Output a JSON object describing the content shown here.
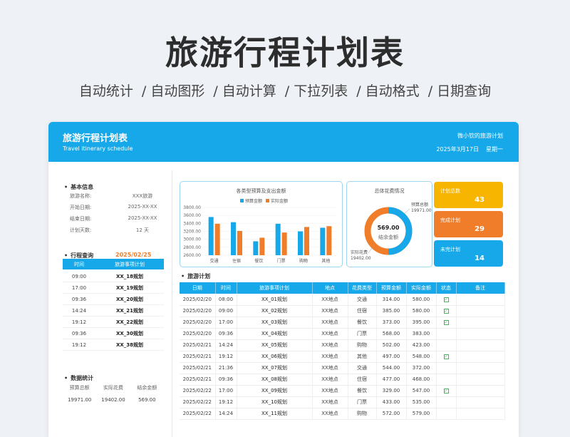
{
  "hero": {
    "title": "旅游行程计划表",
    "features": [
      "自动统计",
      "/ 自动图形",
      "/ 自动计算",
      "/ 下拉列表",
      "/ 自动格式",
      "/ 日期查询"
    ]
  },
  "header": {
    "title": "旅游行程计划表",
    "subtitle": "Travel itinerary schedule",
    "author": "微小钦的旅游计划",
    "date": "2025年3月17日",
    "weekday": "星期一"
  },
  "basic_info": {
    "title": "基本信息",
    "rows": [
      {
        "label": "旅游名称:",
        "value": "XXX旅游"
      },
      {
        "label": "开始日期:",
        "value": "2025-XX-XX"
      },
      {
        "label": "结束日期:",
        "value": "2025-XX-XX"
      },
      {
        "label": "计划天数:",
        "value": "12  天"
      }
    ]
  },
  "schedule_query": {
    "title": "行程查询",
    "date": "2025/02/25",
    "columns": [
      "时间",
      "旅游事项计划"
    ],
    "rows": [
      [
        "09:00",
        "XX_18规划"
      ],
      [
        "17:00",
        "XX_19规划"
      ],
      [
        "09:36",
        "XX_20规划"
      ],
      [
        "14:24",
        "XX_21规划"
      ],
      [
        "19:12",
        "XX_22规划"
      ],
      [
        "09:36",
        "XX_30规划"
      ],
      [
        "19:12",
        "XX_38规划"
      ]
    ]
  },
  "data_stats": {
    "title": "数据统计",
    "labels": [
      "预算总额",
      "实际花费",
      "结余金额"
    ],
    "values": [
      "19971.00",
      "19402.00",
      "569.00"
    ]
  },
  "bar_panel": {
    "title": "各类型预算及支出金额",
    "legend": [
      "预算金额",
      "实际金额"
    ],
    "colors": {
      "budget": "#16a8e8",
      "actual": "#f07d2a"
    }
  },
  "donut_panel": {
    "title": "总体花费情况",
    "center_value": "569.00",
    "center_label": "结余金额",
    "budget_label": "预算总额",
    "budget_value": "19971.00",
    "actual_label": "实际花费",
    "actual_value": "19402.00"
  },
  "kpis": [
    {
      "label": "计划总数",
      "value": "43",
      "color": "#f7b500"
    },
    {
      "label": "完成计划",
      "value": "29",
      "color": "#f07d2a"
    },
    {
      "label": "未完计划",
      "value": "14",
      "color": "#16a8e8"
    }
  ],
  "itinerary": {
    "title": "旅游计划",
    "columns": [
      "日期",
      "时间",
      "旅游事项计划",
      "地点",
      "花费类型",
      "预算金额",
      "实际金额",
      "状态",
      "备注"
    ],
    "rows": [
      [
        "2025/02/20",
        "08:00",
        "XX_01规划",
        "XX地点",
        "交通",
        "314.00",
        "580.00",
        true
      ],
      [
        "2025/02/20",
        "09:00",
        "XX_02规划",
        "XX地点",
        "住宿",
        "385.00",
        "580.00",
        true
      ],
      [
        "2025/02/20",
        "17:00",
        "XX_03规划",
        "XX地点",
        "餐饮",
        "373.00",
        "395.00",
        true
      ],
      [
        "2025/02/20",
        "09:36",
        "XX_04规划",
        "XX地点",
        "门票",
        "568.00",
        "383.00",
        false
      ],
      [
        "2025/02/21",
        "14:24",
        "XX_05规划",
        "XX地点",
        "购物",
        "502.00",
        "423.00",
        false
      ],
      [
        "2025/02/21",
        "19:12",
        "XX_06规划",
        "XX地点",
        "其他",
        "497.00",
        "548.00",
        true
      ],
      [
        "2025/02/21",
        "21:36",
        "XX_07规划",
        "XX地点",
        "交通",
        "544.00",
        "372.00",
        false
      ],
      [
        "2025/02/21",
        "09:36",
        "XX_08规划",
        "XX地点",
        "住宿",
        "477.00",
        "468.00",
        false
      ],
      [
        "2025/02/22",
        "17:00",
        "XX_09规划",
        "XX地点",
        "餐饮",
        "329.00",
        "547.00",
        true
      ],
      [
        "2025/02/22",
        "19:12",
        "XX_10规划",
        "XX地点",
        "门票",
        "433.00",
        "535.00",
        false
      ],
      [
        "2025/02/22",
        "14:24",
        "XX_11规划",
        "XX地点",
        "购物",
        "572.00",
        "579.00",
        false
      ]
    ]
  },
  "chart_data": {
    "type": "bar",
    "title": "各类型预算及支出金额",
    "categories": [
      "交通",
      "住宿",
      "餐饮",
      "门票",
      "购物",
      "其他"
    ],
    "series": [
      {
        "name": "预算金额",
        "values": [
          3560,
          3430,
          2950,
          3390,
          3200,
          3290
        ]
      },
      {
        "name": "实际金额",
        "values": [
          3390,
          3210,
          3040,
          3170,
          3310,
          3330
        ]
      }
    ],
    "yticks": [
      "3800.00",
      "3600.00",
      "3400.00",
      "3200.00",
      "3000.00",
      "2800.00",
      "2600.00"
    ],
    "ylim": [
      2600,
      3800
    ],
    "legend_position": "top"
  }
}
